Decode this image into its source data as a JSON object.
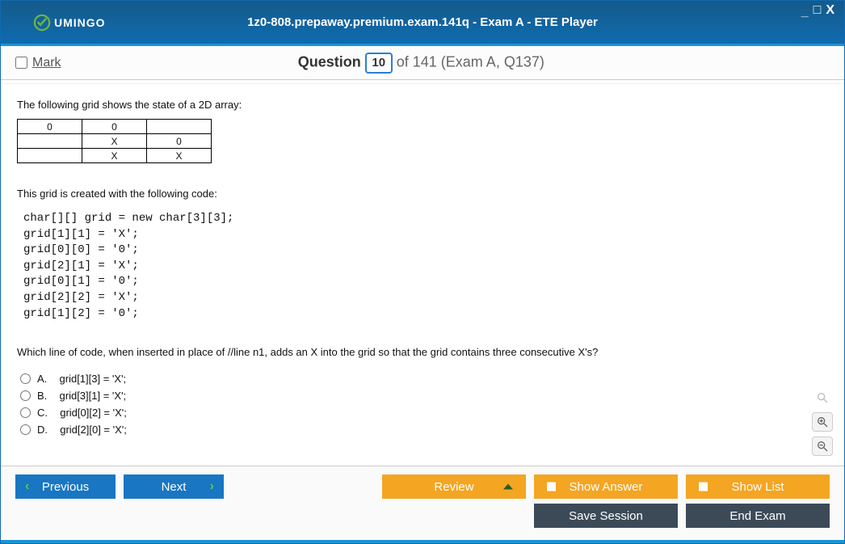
{
  "window": {
    "title": "1z0-808.prepaway.premium.exam.141q - Exam A - ETE Player",
    "logo_text": "UMINGO",
    "controls": {
      "minimize": "_",
      "maximize": "□",
      "close": "X"
    }
  },
  "header": {
    "mark_label": "Mark",
    "question_word": "Question",
    "current": "10",
    "total_phrase": "of 141 (Exam A, Q137)"
  },
  "question": {
    "intro1": "The following grid shows the state of a 2D array:",
    "grid": [
      [
        "0",
        "0",
        ""
      ],
      [
        "",
        "X",
        "0"
      ],
      [
        "",
        "X",
        "X"
      ]
    ],
    "intro2": "This grid is created with the following code:",
    "code": "char[][] grid = new char[3][3];\ngrid[1][1] = 'X';\ngrid[0][0] = '0';\ngrid[2][1] = 'X';\ngrid[0][1] = '0';\ngrid[2][2] = 'X';\ngrid[1][2] = '0';",
    "ask": "Which line of code, when inserted in place of //line n1, adds an X into the grid so that the grid contains three consecutive X's?",
    "options": {
      "A": "grid[1][3] = 'X';",
      "B": "grid[3][1] = 'X';",
      "C": "grid[0][2] = 'X';",
      "D": "grid[2][0] = 'X';"
    }
  },
  "footer": {
    "previous": "Previous",
    "next": "Next",
    "review": "Review",
    "show_answer": "Show Answer",
    "show_list": "Show List",
    "save_session": "Save Session",
    "end_exam": "End Exam"
  }
}
